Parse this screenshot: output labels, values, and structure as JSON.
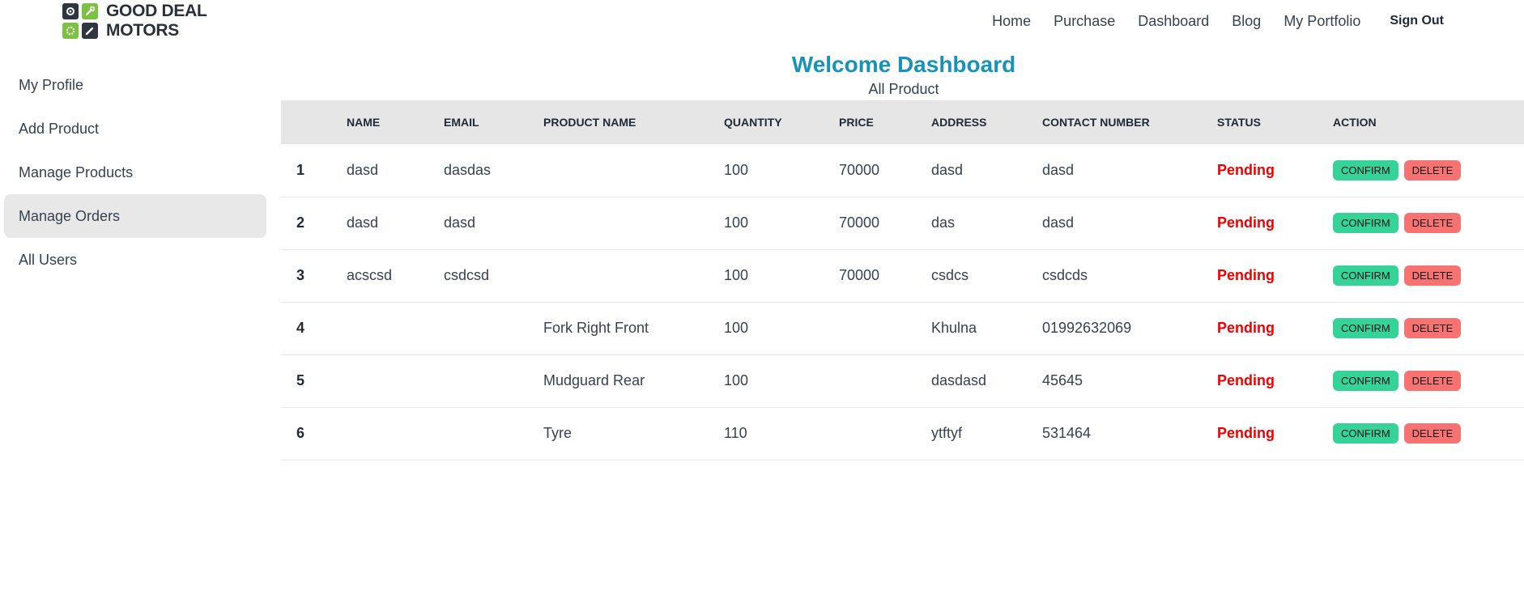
{
  "brand": {
    "line1": "GOOD DEAL",
    "line2": "MOTORS"
  },
  "nav": {
    "items": [
      "Home",
      "Purchase",
      "Dashboard",
      "Blog",
      "My Portfolio"
    ],
    "sign_out": "Sign Out"
  },
  "sidebar": {
    "items": [
      {
        "label": "My Profile",
        "active": false
      },
      {
        "label": "Add Product",
        "active": false
      },
      {
        "label": "Manage Products",
        "active": false
      },
      {
        "label": "Manage Orders",
        "active": true
      },
      {
        "label": "All Users",
        "active": false
      }
    ]
  },
  "page": {
    "title": "Welcome Dashboard",
    "subtitle": "All Product"
  },
  "table": {
    "headers": [
      "",
      "NAME",
      "EMAIL",
      "PRODUCT NAME",
      "QUANTITY",
      "PRICE",
      "ADDRESS",
      "CONTACT NUMBER",
      "STATUS",
      "ACTION"
    ],
    "rows": [
      {
        "num": "1",
        "name": "dasd",
        "email": "dasdas",
        "product": "",
        "quantity": "100",
        "price": "70000",
        "address": "dasd",
        "contact": "dasd",
        "status": "Pending"
      },
      {
        "num": "2",
        "name": "dasd",
        "email": "dasd",
        "product": "",
        "quantity": "100",
        "price": "70000",
        "address": "das",
        "contact": "dasd",
        "status": "Pending"
      },
      {
        "num": "3",
        "name": "acscsd",
        "email": "csdcsd",
        "product": "",
        "quantity": "100",
        "price": "70000",
        "address": "csdcs",
        "contact": "csdcds",
        "status": "Pending"
      },
      {
        "num": "4",
        "name": "",
        "email": "",
        "product": "Fork Right Front",
        "quantity": "100",
        "price": "",
        "address": "Khulna",
        "contact": "01992632069",
        "status": "Pending"
      },
      {
        "num": "5",
        "name": "",
        "email": "",
        "product": "Mudguard Rear",
        "quantity": "100",
        "price": "",
        "address": "dasdasd",
        "contact": "45645",
        "status": "Pending"
      },
      {
        "num": "6",
        "name": "",
        "email": "",
        "product": "Tyre",
        "quantity": "110",
        "price": "",
        "address": "ytftyf",
        "contact": "531464",
        "status": "Pending"
      }
    ],
    "confirm_label": "CONFIRM",
    "delete_label": "DELETE"
  },
  "colors": {
    "title": "#1793b8",
    "status_pending": "#ef0000",
    "confirm_bg": "#36d399",
    "delete_bg": "#f87272",
    "header_bg": "#e6e6e6",
    "active_sidebar_bg": "#e8e8e8",
    "logo_green": "#7cc242",
    "logo_dark": "#2f3640"
  }
}
